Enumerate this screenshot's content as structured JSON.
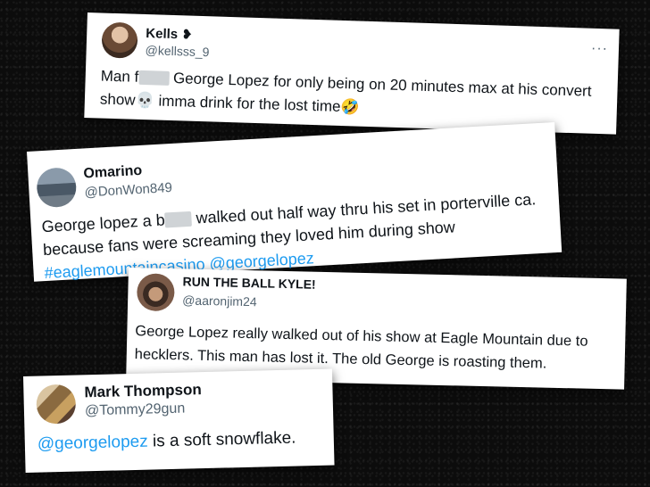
{
  "tweets": [
    {
      "name": "Kells",
      "name_suffix": "❥",
      "handle": "@kellsss_9",
      "more": "···",
      "line1_a": "Man f",
      "line1_b": "George Lopez for only being on 20 minutes max at his convert",
      "line2_a": "show",
      "line2_emoji": "💀",
      "line2_b": "imma drink for the lost time",
      "line2_emoji2": "🤣"
    },
    {
      "name": "Omarino",
      "handle": "@DonWon849",
      "line1_a": "George lopez a b",
      "line1_b": "walked out half way thru his set in porterville ca.",
      "line2": "because fans were screaming they loved him during show",
      "tag1": "#eaglemountaincasino",
      "tag2": "@georgelopez"
    },
    {
      "name": "RUN THE BALL KYLE!",
      "handle": "@aaronjim24",
      "line1": "George Lopez really walked out of his show at Eagle Mountain due to",
      "line2": "hecklers. This man has lost it. The old George is roasting them."
    },
    {
      "name": "Mark Thompson",
      "handle": "@Tommy29gun",
      "mention": "@georgelopez",
      "text": "is a soft snowflake."
    }
  ],
  "colors": {
    "link": "#1d9bf0",
    "handle": "#536471",
    "text": "#0f1419"
  }
}
